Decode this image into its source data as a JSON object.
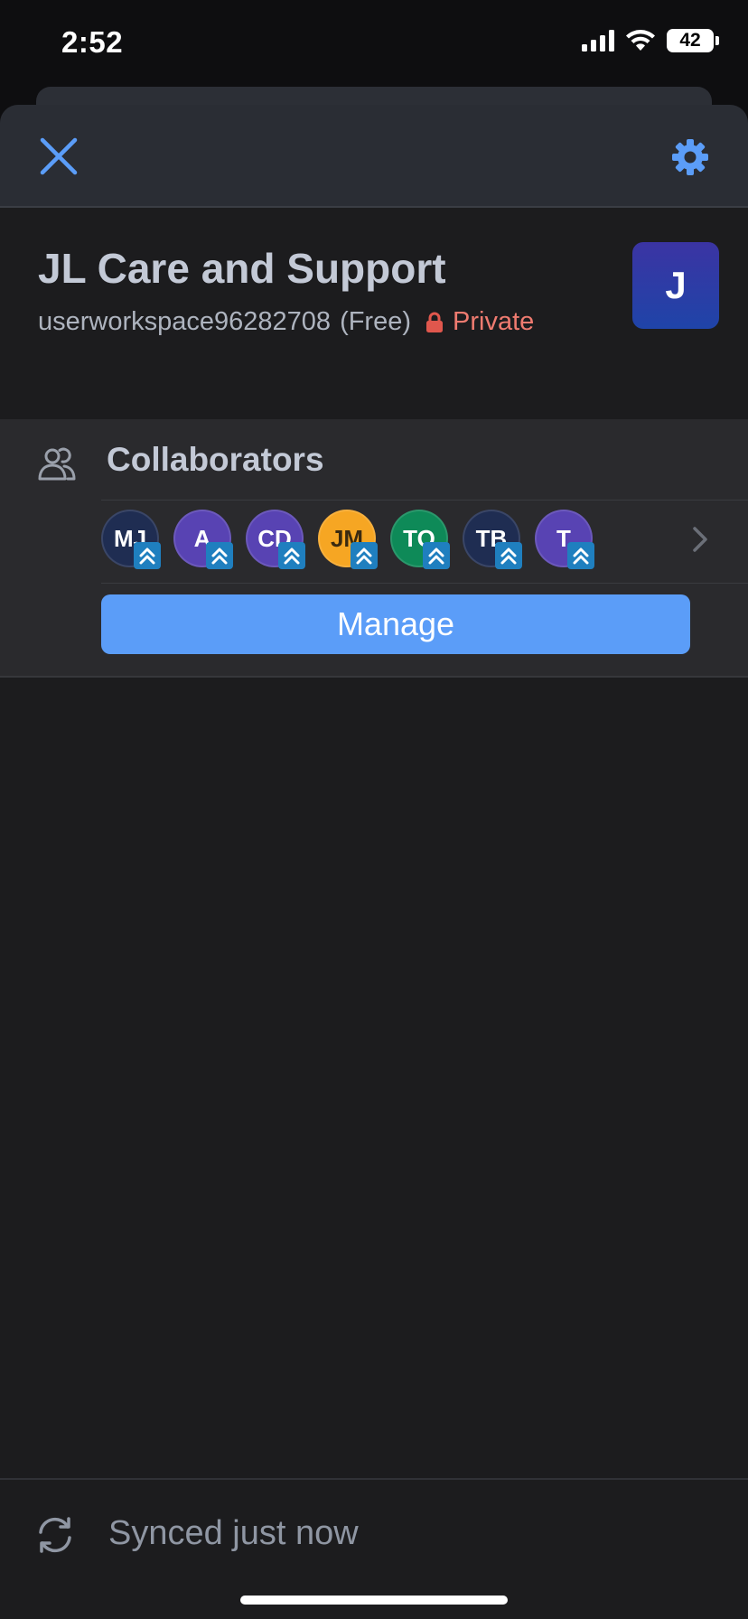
{
  "status_bar": {
    "time": "2:52",
    "battery": "42",
    "icons": [
      "signal-icon",
      "wifi-icon",
      "battery-icon"
    ]
  },
  "header": {
    "close_icon": "close-icon",
    "settings_icon": "gear-icon"
  },
  "workspace": {
    "title": "JL Care and Support",
    "id": "userworkspace96282708",
    "plan": "(Free)",
    "privacy": "Private",
    "avatar_letter": "J"
  },
  "collaborators": {
    "title": "Collaborators",
    "avatars": [
      {
        "initials": "MJ",
        "color": "#1f2d52",
        "text_color": "#ffffff"
      },
      {
        "initials": "A",
        "color": "#5843b3",
        "text_color": "#ffffff"
      },
      {
        "initials": "CD",
        "color": "#5843b3",
        "text_color": "#ffffff"
      },
      {
        "initials": "JM",
        "color": "#f6a623",
        "text_color": "#3a2a10"
      },
      {
        "initials": "TO",
        "color": "#0e8a58",
        "text_color": "#ffffff"
      },
      {
        "initials": "TB",
        "color": "#1f2d52",
        "text_color": "#ffffff"
      },
      {
        "initials": "T",
        "color": "#5843b3",
        "text_color": "#ffffff"
      }
    ],
    "manage_label": "Manage"
  },
  "footer": {
    "sync_text": "Synced just now"
  },
  "colors": {
    "accent": "#5b9df8",
    "privacy": "#ef7b70",
    "background": "#1c1c1e"
  }
}
